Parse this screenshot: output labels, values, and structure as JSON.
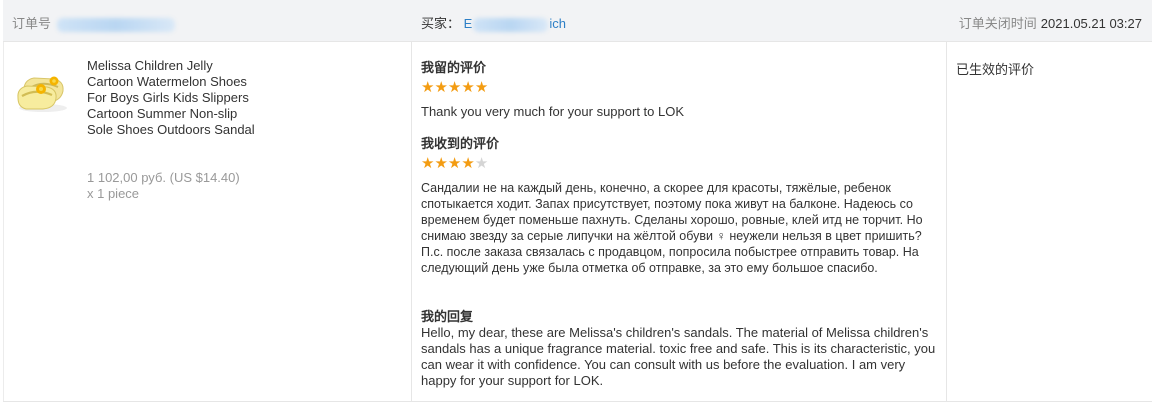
{
  "header": {
    "order_label": "订单号",
    "buyer_label": "买家：",
    "buyer_prefix": "E",
    "buyer_suffix": "ich",
    "close_time_label": "订单关闭时间",
    "close_time_value": "2021.05.21 03:27"
  },
  "product": {
    "title": "Melissa Children Jelly Cartoon Watermelon Shoes For Boys Girls Kids Slippers Cartoon Summer Non-slip Sole Shoes Outdoors Sandal",
    "price": "1 102,00 руб. (US $14.40)",
    "quantity": "x 1 piece",
    "thumbnail_icon": "sandal-thumbnail"
  },
  "my_review": {
    "label": "我留的评价",
    "rating": 5,
    "max_rating": 5,
    "text": "Thank you very much for your support to LOK"
  },
  "received_review": {
    "label": "我收到的评价",
    "rating": 4,
    "max_rating": 5,
    "text": "Сандалии не на каждый день, конечно, а скорее для красоты, тяжёлые, ребенок спотыкается ходит. Запах присутствует, поэтому пока живут на балконе. Надеюсь со временем будет поменьше пахнуть. Сделаны хорошо, ровные, клей итд не торчит. Но снимаю звезду за серые липучки на жёлтой обуви ♀ неужели нельзя в цвет пришить? П.с. после заказа связалась с продавцом, попросила побыстрее отправить товар. На следующий день уже была отметка об отправке, за это ему большое спасибо."
  },
  "my_reply": {
    "label": "我的回复",
    "text": "Hello, my dear, these are Melissa's children's sandals. The material of Melissa children's sandals has a unique fragrance material. toxic free and safe. This is its characteristic, you can wear it with confidence. You can consult with us before the evaluation. I am very happy for your support for LOK."
  },
  "status": {
    "text": "已生效的评价"
  },
  "colors": {
    "star_on": "#f39c12",
    "star_off": "#d5d5d5",
    "link_blue": "#2d7fc6",
    "header_bg": "#f2f3f5"
  }
}
